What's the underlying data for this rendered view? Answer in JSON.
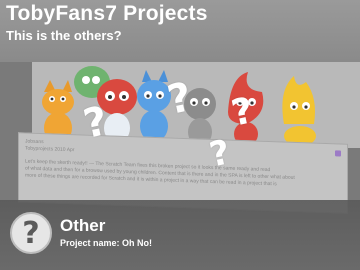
{
  "header": {
    "title": "TobyFans7 Projects",
    "subtitle": "This is the others?"
  },
  "banner": {
    "character-icons": [
      "cat-character-icon",
      "red-character-icon",
      "blue-character-icon",
      "gray-character-icon",
      "red-flame-character-icon",
      "yellow-character-icon",
      "green-character-icon"
    ]
  },
  "description": {
    "username": "Jobsans",
    "date": "Tobyprojects 2010 Apr",
    "body_line1": "Let's keep the skerth ready!! — The Scratch Team fixes this broken project so it looks the same ready and read",
    "body_line2": "of what data and then for a browsw used by young children. Content that is there and in the SPA is left to other what about",
    "body_line3": "more of these things are recorded for Scratch and it is within a project in a way that can be read in a project that is"
  },
  "info": {
    "icon_glyph": "?",
    "title": "Other",
    "subtitle": "Project name: Oh No!"
  },
  "overlay": {
    "marks": [
      "?",
      "?",
      "?",
      "?"
    ]
  }
}
